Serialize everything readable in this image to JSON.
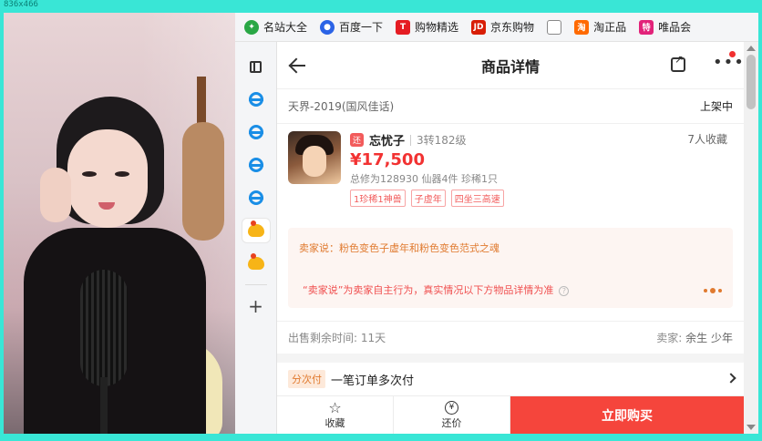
{
  "frame": {
    "label": "836x466"
  },
  "bookmarks": [
    {
      "label": "名站大全",
      "icon": "globe-icon",
      "color": "#29a745"
    },
    {
      "label": "百度一下",
      "icon": "baidu-paw-icon",
      "color": "#2b63e6"
    },
    {
      "label": "购物精选",
      "icon": "tmall-icon",
      "color": "#e51c23"
    },
    {
      "label": "京东购物",
      "icon": "jd-icon",
      "color": "#d81e06"
    },
    {
      "label": "",
      "icon": "page-icon",
      "color": "#888888"
    },
    {
      "label": "淘正品",
      "icon": "tao-icon",
      "color": "#ff6a00"
    },
    {
      "label": "唯品会",
      "icon": "vip-icon",
      "color": "#e2237a"
    }
  ],
  "header": {
    "title": "商品详情"
  },
  "listing": {
    "server": "天界-2019(国风佳话)",
    "status": "上架中",
    "badge": "还",
    "name": "忘忧子",
    "level": "3转182级",
    "favorites": "7人收藏",
    "price": "¥17,500",
    "stats": "总修为128930  仙器4件  珍稀1只",
    "chips": [
      "1珍稀1神兽",
      "子虚年",
      "四坐三高速"
    ]
  },
  "seller_box": {
    "says": "卖家说：粉色变色子虚年和粉色变色范式之魂",
    "disclaimer": "“卖家说”为卖家自主行为，真实情况以下方物品详情为准",
    "help": "?"
  },
  "meta": {
    "time_left": "出售剩余时间: 11天",
    "seller_label": "卖家:",
    "seller_name": "余生 少年"
  },
  "payment": {
    "tag": "分次付",
    "text": "一笔订单多次付"
  },
  "bottom": {
    "fav_label": "收藏",
    "bargain_label": "还价",
    "bargain_icon_text": "¥",
    "buy_label": "立即购买"
  },
  "colors": {
    "accent_red": "#f5453c",
    "price_red": "#f23232",
    "frame_teal": "#39e6d6",
    "seller_orange": "#e07a2f"
  }
}
